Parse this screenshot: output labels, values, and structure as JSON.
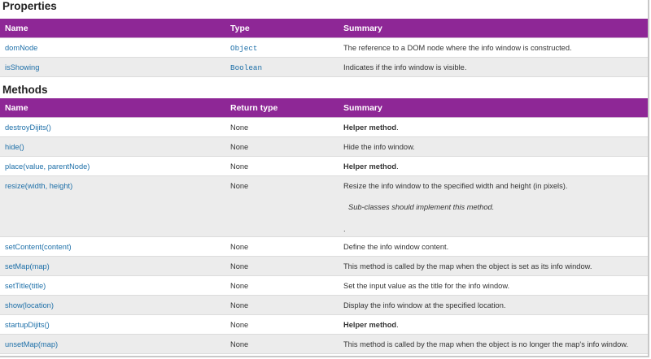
{
  "properties": {
    "heading": "Properties",
    "columns": [
      "Name",
      "Type",
      "Summary"
    ],
    "rows": [
      {
        "name": "domNode",
        "type": "Object",
        "summary": "The reference to a DOM node where the info window is constructed."
      },
      {
        "name": "isShowing",
        "type": "Boolean",
        "summary": "Indicates if the info window is visible."
      }
    ]
  },
  "methods": {
    "heading": "Methods",
    "columns": [
      "Name",
      "Return type",
      "Summary"
    ],
    "rows": [
      {
        "name": "destroyDijits()",
        "return": "None",
        "summary_bold": "Helper method",
        "summary": "."
      },
      {
        "name": "hide()",
        "return": "None",
        "summary": "Hide the info window."
      },
      {
        "name": "place(value, parentNode)",
        "return": "None",
        "summary_bold": "Helper method",
        "summary": "."
      },
      {
        "name": "resize(width, height)",
        "return": "None",
        "summary": "Resize the info window to the specified width and height (in pixels).",
        "note": "Sub-classes should implement this method.",
        "trail": "."
      },
      {
        "name": "setContent(content)",
        "return": "None",
        "summary": "Define the info window content."
      },
      {
        "name": "setMap(map)",
        "return": "None",
        "summary": "This method is called by the map when the object is set as its info window."
      },
      {
        "name": "setTitle(title)",
        "return": "None",
        "summary": "Set the input value as the title for the info window."
      },
      {
        "name": "show(location)",
        "return": "None",
        "summary": "Display the info window at the specified location."
      },
      {
        "name": "startupDijits()",
        "return": "None",
        "summary_bold": "Helper method",
        "summary": "."
      },
      {
        "name": "unsetMap(map)",
        "return": "None",
        "summary": "This method is called by the map when the object is no longer the map's info window."
      }
    ]
  }
}
